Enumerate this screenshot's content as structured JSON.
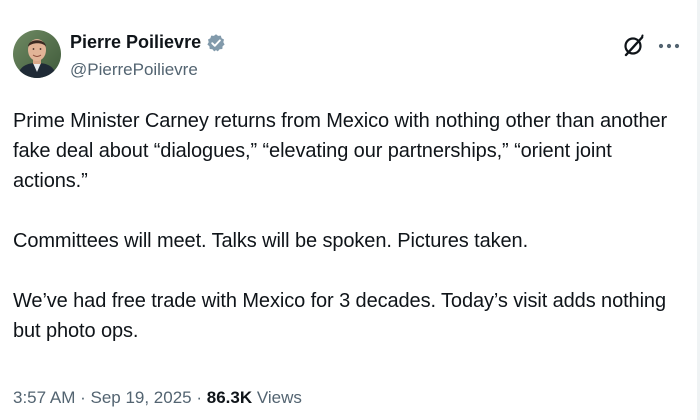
{
  "author": {
    "display_name": "Pierre Poilievre",
    "handle": "@PierrePoilievre",
    "verified_icon": "verified-badge-icon",
    "verified_color": "#829aab"
  },
  "header_actions": {
    "grok_icon": "grok-icon",
    "more_icon": "more-options-icon"
  },
  "tweet": {
    "paragraphs": [
      "Prime Minister Carney returns from Mexico with nothing other than another fake deal about “dialogues,” “elevating our partnerships,” “orient joint actions.”",
      "Committees will meet. Talks will be spoken. Pictures taken.",
      "We’ve had free trade with Mexico for 3 decades. Today’s visit adds nothing but photo ops."
    ]
  },
  "meta": {
    "time": "3:57 AM",
    "separator": " · ",
    "date": "Sep 19, 2025",
    "views_count": "86.3K",
    "views_label": " Views"
  },
  "colors": {
    "text_primary": "#0f1419",
    "text_secondary": "#536471"
  }
}
